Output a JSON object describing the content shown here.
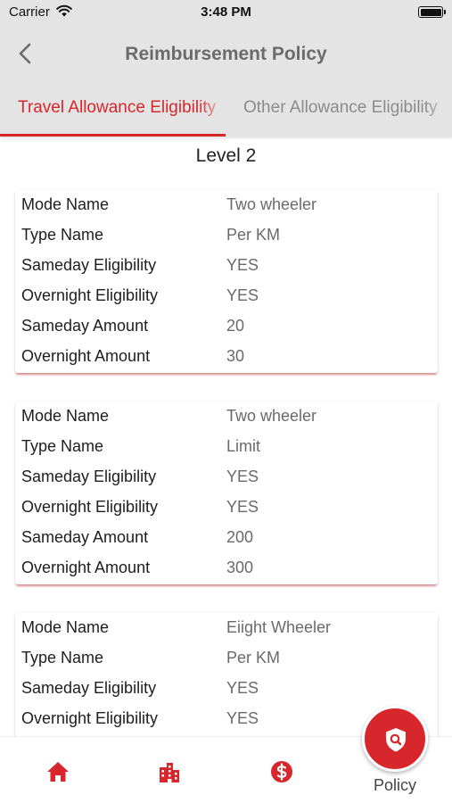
{
  "status_bar": {
    "carrier": "Carrier",
    "time": "3:48 PM"
  },
  "header": {
    "title": "Reimbursement Policy",
    "tabs": [
      {
        "label": "Travel Allowance Eligibility",
        "active": true
      },
      {
        "label": "Other Allowance Eligibility",
        "active": false
      }
    ]
  },
  "level_title": "Level 2",
  "cards": [
    {
      "rows": [
        {
          "key": "Mode Name",
          "value": "Two wheeler"
        },
        {
          "key": "Type Name",
          "value": "Per KM"
        },
        {
          "key": "Sameday Eligibility",
          "value": "YES"
        },
        {
          "key": "Overnight Eligibility",
          "value": "YES"
        },
        {
          "key": "Sameday Amount",
          "value": "20"
        },
        {
          "key": "Overnight Amount",
          "value": "30"
        }
      ]
    },
    {
      "rows": [
        {
          "key": "Mode Name",
          "value": "Two wheeler"
        },
        {
          "key": "Type Name",
          "value": "Limit"
        },
        {
          "key": "Sameday Eligibility",
          "value": "YES"
        },
        {
          "key": "Overnight Eligibility",
          "value": "YES"
        },
        {
          "key": "Sameday Amount",
          "value": "200"
        },
        {
          "key": "Overnight Amount",
          "value": "300"
        }
      ]
    },
    {
      "rows": [
        {
          "key": "Mode Name",
          "value": "Eiight Wheeler"
        },
        {
          "key": "Type Name",
          "value": "Per KM"
        },
        {
          "key": "Sameday Eligibility",
          "value": "YES"
        },
        {
          "key": "Overnight Eligibility",
          "value": "YES"
        }
      ]
    }
  ],
  "bottom_nav": {
    "items": [
      {
        "icon": "home-icon"
      },
      {
        "icon": "company-icon"
      },
      {
        "icon": "dollar-icon"
      },
      {
        "icon": "policy-shield-icon",
        "label": "Policy",
        "active": true
      }
    ]
  },
  "colors": {
    "accent": "#d7262c",
    "header_bg": "#e4e4e4",
    "title_gray": "#6b6b6b",
    "inactive_tab": "#8b8b8b"
  }
}
